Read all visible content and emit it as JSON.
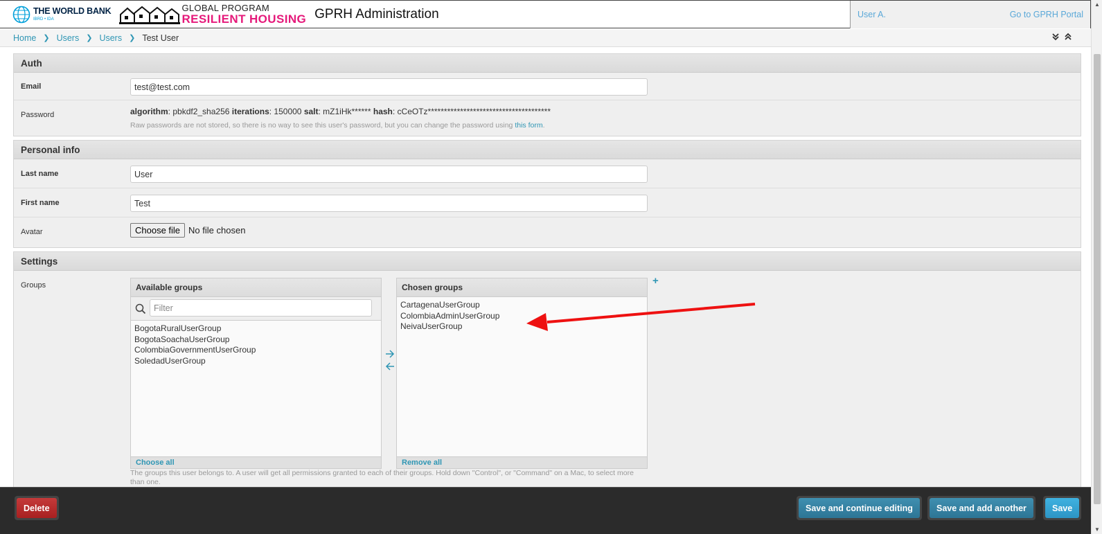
{
  "header": {
    "world_bank_name": "THE WORLD BANK",
    "world_bank_sub": "IBRD • IDA",
    "gp_line1": "GLOBAL PROGRAM",
    "gp_line2": "RESILIENT HOUSING",
    "site_title": "GPRH Administration",
    "user_link": "User A.",
    "portal_link": "Go to GPRH Portal"
  },
  "breadcrumbs": {
    "home": "Home",
    "app": "Users",
    "model": "Users",
    "current": "Test User"
  },
  "auth": {
    "title": "Auth",
    "email_label": "Email",
    "email_value": "test@test.com",
    "password_label": "Password",
    "pw_algorithm_key": "algorithm",
    "pw_algorithm_val": ": pbkdf2_sha256 ",
    "pw_iterations_key": "iterations",
    "pw_iterations_val": ": 150000 ",
    "pw_salt_key": "salt",
    "pw_salt_val": ": mZ1iHk****** ",
    "pw_hash_key": "hash",
    "pw_hash_val": ": cCeOTz**************************************",
    "pw_help": "Raw passwords are not stored, so there is no way to see this user's password, but you can change the password using ",
    "pw_help_link": "this form",
    "pw_help_end": "."
  },
  "personal": {
    "title": "Personal info",
    "last_name_label": "Last name",
    "last_name_value": "User",
    "first_name_label": "First name",
    "first_name_value": "Test",
    "avatar_label": "Avatar",
    "file_button": "Choose file",
    "file_status": "No file chosen"
  },
  "settings": {
    "title": "Settings",
    "groups_label": "Groups",
    "available_title": "Available groups",
    "filter_placeholder": "Filter",
    "available_groups": [
      "BogotaRuralUserGroup",
      "BogotaSoachaUserGroup",
      "ColombiaGovernmentUserGroup",
      "SoledadUserGroup"
    ],
    "choose_all": "Choose all",
    "chosen_title": "Chosen groups",
    "chosen_groups": [
      "CartagenaUserGroup",
      "ColombiaAdminUserGroup",
      "NeivaUserGroup"
    ],
    "remove_all": "Remove all",
    "add_symbol": "+",
    "groups_help": "The groups this user belongs to. A user will get all permissions granted to each of their groups. Hold down \"Control\", or \"Command\" on a Mac, to select more than one."
  },
  "submit": {
    "delete": "Delete",
    "save_continue": "Save and continue editing",
    "save_add": "Save and add another",
    "save": "Save"
  },
  "colors": {
    "link": "#2f96b4",
    "brand_pink": "#e5197a",
    "annotation_arrow": "#ee1111"
  }
}
